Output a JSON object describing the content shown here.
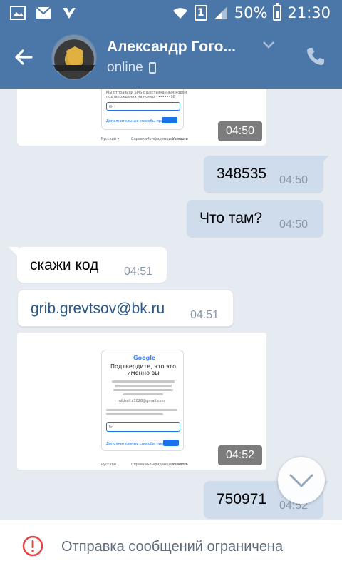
{
  "status_bar": {
    "icons": [
      "gallery-icon",
      "mail-icon",
      "checkmark-app-icon",
      "wifi-icon",
      "sim-icon",
      "signal-icon",
      "battery-icon"
    ],
    "sim_label": "1",
    "battery_percent": "50%",
    "time": "21:30"
  },
  "header": {
    "contact_name": "Александр Гого...",
    "status": "online",
    "accent_color": "#4a76a8"
  },
  "messages": [
    {
      "type": "image",
      "direction": "incoming",
      "time": "04:50"
    },
    {
      "type": "text",
      "direction": "outgoing",
      "text": "348535",
      "time": "04:50"
    },
    {
      "type": "text",
      "direction": "outgoing",
      "text": "Что там?",
      "time": "04:50"
    },
    {
      "type": "text",
      "direction": "incoming",
      "text": "скажи код",
      "time": "04:51"
    },
    {
      "type": "text",
      "direction": "incoming",
      "text": "grib.grevtsov@bk.ru",
      "time": "04:51",
      "is_link": true
    },
    {
      "type": "image",
      "direction": "incoming",
      "time": "04:52"
    },
    {
      "type": "text",
      "direction": "outgoing",
      "text": "750971",
      "time": "04:52"
    }
  ],
  "photo2": {
    "logo": "Google",
    "title": "Подтвердите, что это именно вы",
    "body": "Некоторые ваши действия кажутся нам подозрительными. В целях вашей безопасности мы хотим убедиться, что это действительно вы.",
    "account": "mikhail.c1028@gmail.com",
    "sms_note": "Мы отправили SMS с шестизначным кодом подтверждения на номер •••••••98",
    "input_label": "Введите код",
    "input_prefix": "G-",
    "other_options": "Дополнительные способы проверки",
    "next_button": "Далее",
    "footer_lang": "Русский",
    "footer_links": [
      "Справка",
      "Конфиденциальность",
      "Условия"
    ]
  },
  "photo1": {
    "sms_note": "Мы отправили SMS с шестизначным кодом подтверждения на номер •••••••98",
    "input_label": "Введите код",
    "input_prefix": "G-",
    "other_options": "Дополнительные способы проверки",
    "next_button": "Далее",
    "footer_lang": "Русский",
    "footer_links": [
      "Справка",
      "Конфиденциальность",
      "Условия"
    ]
  },
  "footer": {
    "notice": "Отправка сообщений ограничена",
    "icon": "alert-circle-icon",
    "icon_color": "#e64646"
  }
}
